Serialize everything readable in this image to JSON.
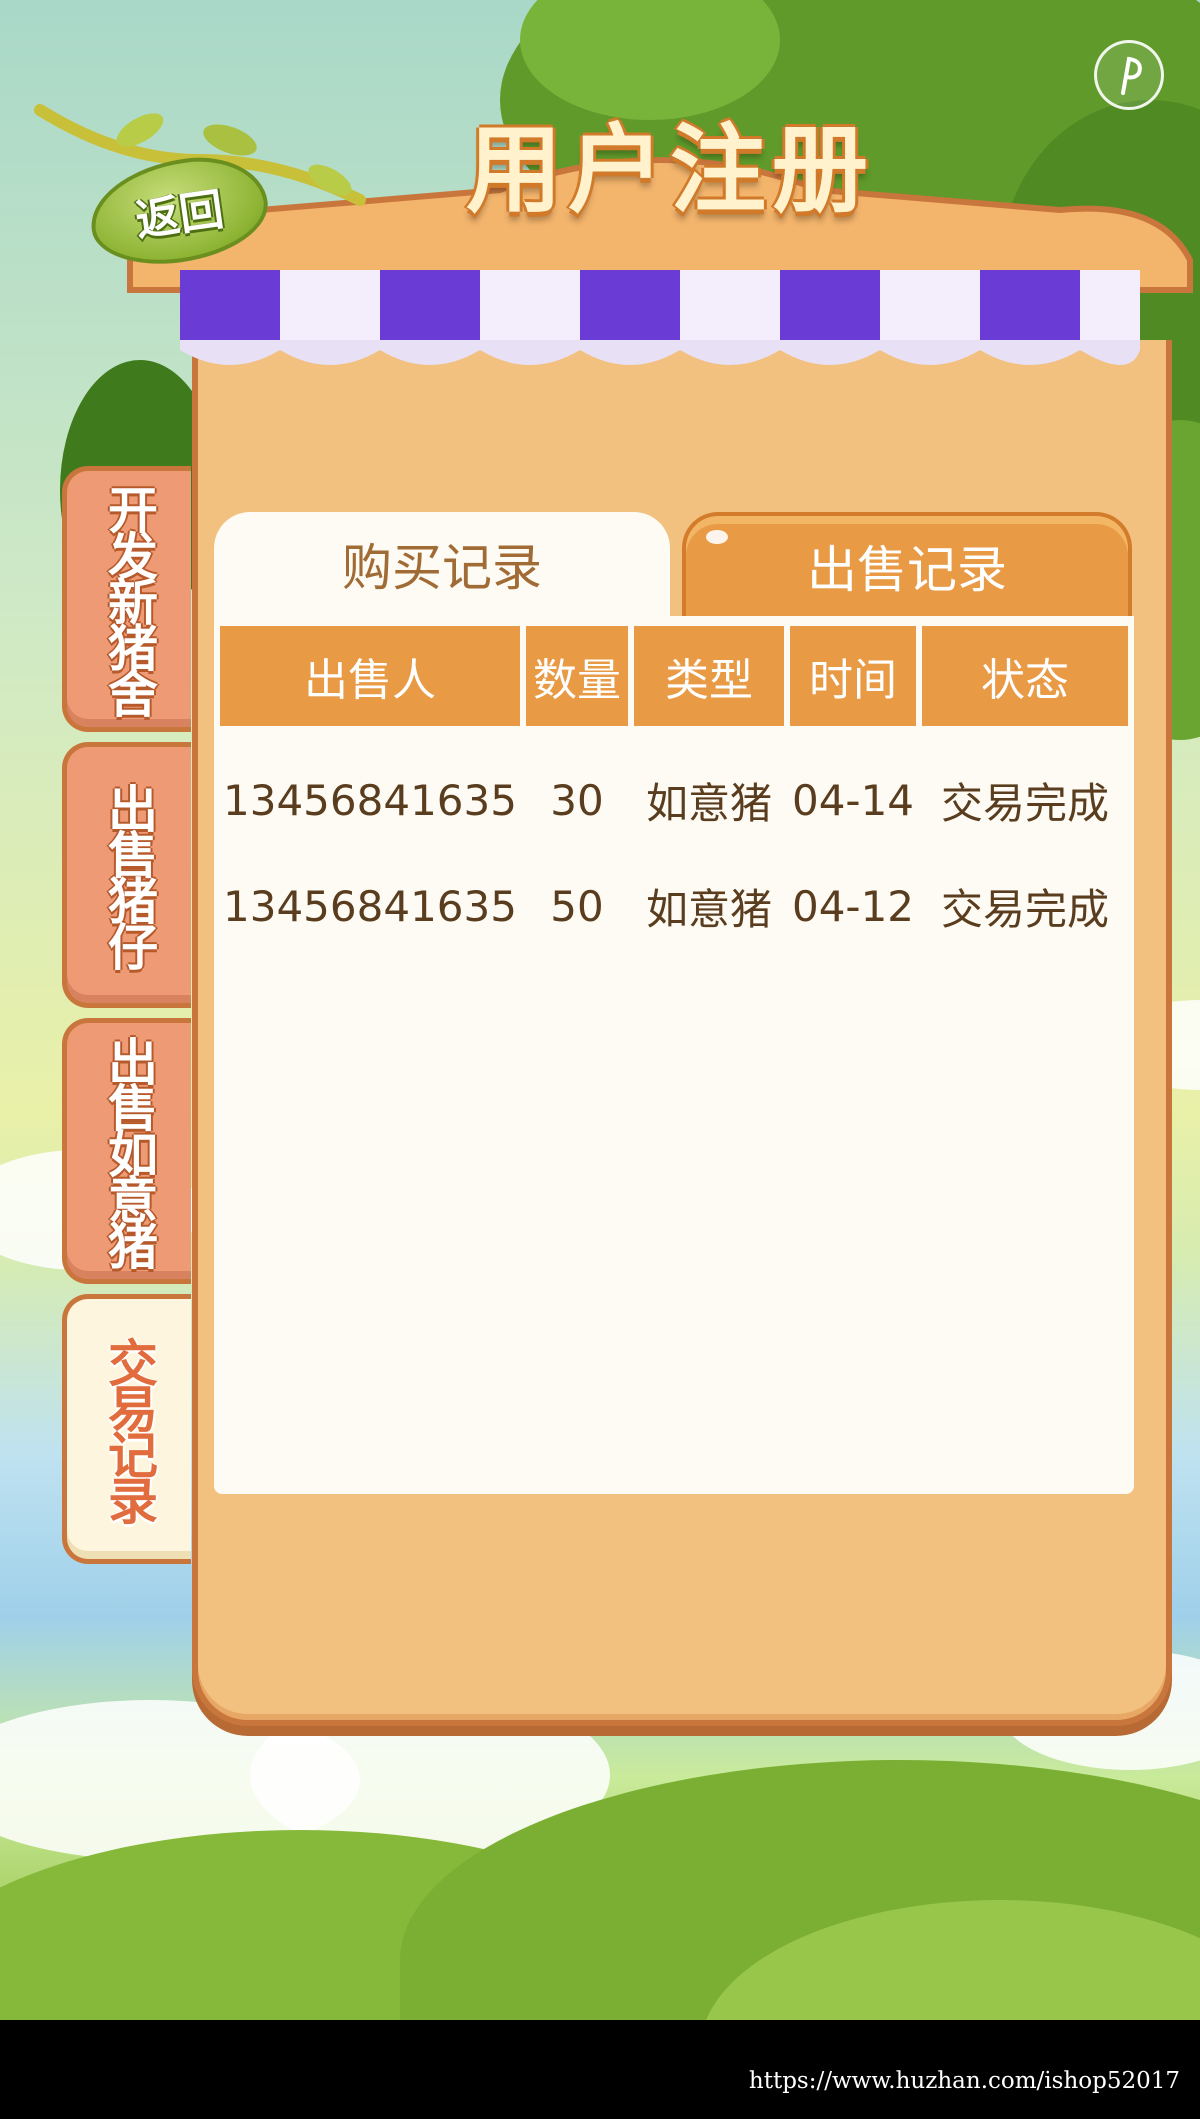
{
  "header": {
    "title": "用户注册",
    "back_label": "返回"
  },
  "side_nav": {
    "items": [
      {
        "label": "开发新猪舍",
        "active": false
      },
      {
        "label": "出售猪仔",
        "active": false
      },
      {
        "label": "出售如意猪",
        "active": false
      },
      {
        "label": "交易记录",
        "active": true
      }
    ]
  },
  "record_tabs": {
    "buy": "购买记录",
    "sell": "出售记录",
    "active": "buy"
  },
  "table": {
    "headers": [
      "出售人",
      "数量",
      "类型",
      "时间",
      "状态"
    ],
    "rows": [
      [
        "13456841635",
        "30",
        "如意猪",
        "04-14",
        "交易完成"
      ],
      [
        "13456841635",
        "50",
        "如意猪",
        "04-12",
        "交易完成"
      ]
    ]
  },
  "icons": {
    "top_right": "music-note-icon"
  },
  "colors": {
    "panel": "#f2c07f",
    "tab_orange": "#e99a45",
    "awning_purple": "#6b3bd6",
    "side_tab": "#ee9a74"
  },
  "watermark": "https://www.huzhan.com/ishop52017"
}
